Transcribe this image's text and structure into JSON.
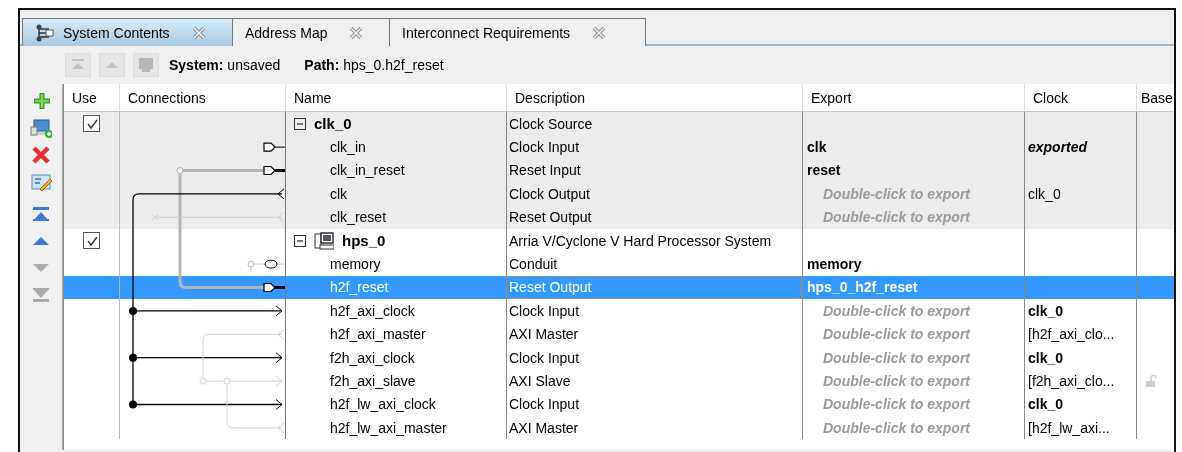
{
  "tabs": [
    {
      "label": "System Contents",
      "selected": true
    },
    {
      "label": "Address Map",
      "selected": false
    },
    {
      "label": "Interconnect Requirements",
      "selected": false
    }
  ],
  "toolbar": {
    "buttons": [
      {
        "kind": "top",
        "disabled": true
      },
      {
        "kind": "up",
        "disabled": true
      },
      {
        "kind": "system",
        "disabled": true
      }
    ],
    "system": "**System:** unsaved",
    "path": "**Path:** hps_0.h2f_reset"
  },
  "side_tools": [
    {
      "kind": "add",
      "disabled": false
    },
    {
      "kind": "add-system",
      "disabled": false
    },
    {
      "kind": "remove",
      "disabled": false
    },
    {
      "kind": "edit",
      "disabled": false
    },
    {
      "kind": "top",
      "disabled": false
    },
    {
      "kind": "up",
      "disabled": false
    },
    {
      "kind": "down",
      "disabled": true
    },
    {
      "kind": "bottom",
      "disabled": true
    }
  ],
  "table": {
    "columns": [
      "Use",
      "Connections",
      "Name",
      "Description",
      "Export",
      "Clock",
      "Base"
    ],
    "modules": [
      {
        "name": "clk_0",
        "kind": "clock",
        "description": "Clock Source",
        "use": true,
        "expanded": true,
        "selected": false,
        "children": [
          {
            "name": "clk_in",
            "description": "Clock Input",
            "export": {
              "text": "clk",
              "kind": "exported"
            },
            "clock": {
              "text": "exported",
              "kind": "italic"
            },
            "locked": false,
            "selected": false
          },
          {
            "name": "clk_in_reset",
            "description": "Reset Input",
            "export": {
              "text": "reset",
              "kind": "exported"
            },
            "locked": false,
            "selected": false
          },
          {
            "name": "clk",
            "description": "Clock Output",
            "export": {
              "text": "Double-click to export",
              "kind": "hint"
            },
            "clock": {
              "text": "clk_0",
              "kind": "plain"
            },
            "locked": false,
            "selected": false
          },
          {
            "name": "clk_reset",
            "description": "Reset Output",
            "export": {
              "text": "Double-click to export",
              "kind": "hint"
            },
            "locked": false,
            "selected": false
          }
        ]
      },
      {
        "name": "hps_0",
        "kind": "processor",
        "description": "Arria V/Cyclone V Hard Processor System",
        "use": true,
        "expanded": true,
        "selected": false,
        "children": [
          {
            "name": "memory",
            "description": "Conduit",
            "export": {
              "text": "memory",
              "kind": "exported"
            },
            "locked": false,
            "selected": false
          },
          {
            "name": "h2f_reset",
            "description": "Reset Output",
            "export": {
              "text": "hps_0_h2f_reset",
              "kind": "exported"
            },
            "locked": false,
            "selected": true
          },
          {
            "name": "h2f_axi_clock",
            "description": "Clock Input",
            "export": {
              "text": "Double-click to export",
              "kind": "hint"
            },
            "clock": {
              "text": "clk_0",
              "kind": "bold"
            },
            "locked": false,
            "selected": false
          },
          {
            "name": "h2f_axi_master",
            "description": "AXI Master",
            "export": {
              "text": "Double-click to export",
              "kind": "hint"
            },
            "clock": {
              "text": "[h2f_axi_clo...",
              "kind": "plain"
            },
            "locked": false,
            "selected": false
          },
          {
            "name": "f2h_axi_clock",
            "description": "Clock Input",
            "export": {
              "text": "Double-click to export",
              "kind": "hint"
            },
            "clock": {
              "text": "clk_0",
              "kind": "bold"
            },
            "locked": false,
            "selected": false
          },
          {
            "name": "f2h_axi_slave",
            "description": "AXI Slave",
            "export": {
              "text": "Double-click to export",
              "kind": "hint"
            },
            "clock": {
              "text": "[f2h_axi_clo...",
              "kind": "plain"
            },
            "locked": true,
            "selected": false
          },
          {
            "name": "h2f_lw_axi_clock",
            "description": "Clock Input",
            "export": {
              "text": "Double-click to export",
              "kind": "hint"
            },
            "clock": {
              "text": "clk_0",
              "kind": "bold"
            },
            "locked": false,
            "selected": false
          },
          {
            "name": "h2f_lw_axi_master",
            "description": "AXI Master",
            "export": {
              "text": "Double-click to export",
              "kind": "hint"
            },
            "clock": {
              "text": "[h2f_lw_axi...",
              "kind": "plain"
            },
            "locked": false,
            "selected": false
          }
        ]
      }
    ]
  }
}
